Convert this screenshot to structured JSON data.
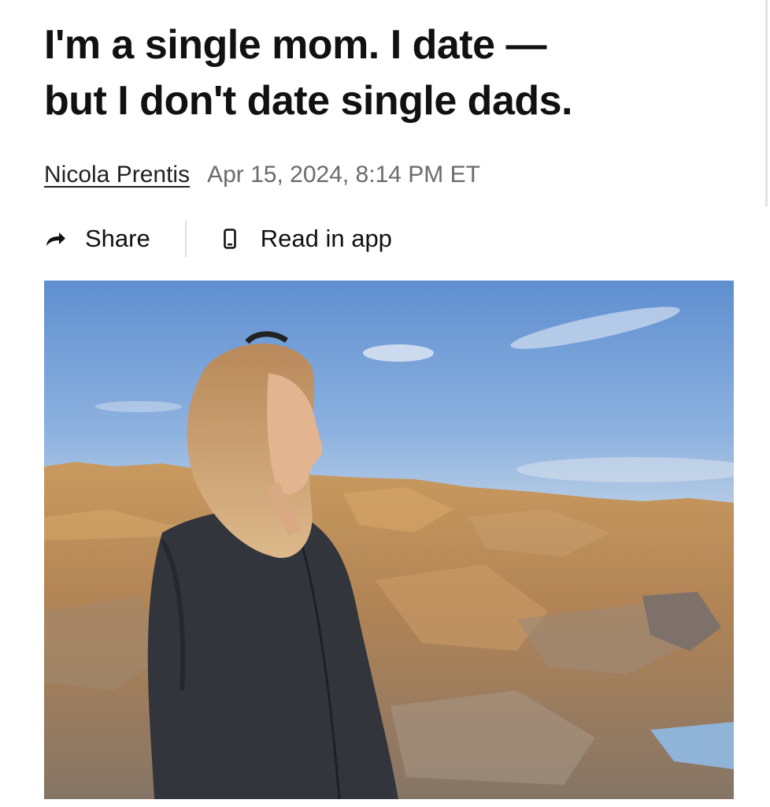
{
  "article": {
    "headline_line1": "I'm a single mom. I date —",
    "headline_line2": "but I don't date single dads.",
    "author": "Nicola Prentis",
    "timestamp": "Apr 15, 2024, 8:14 PM ET"
  },
  "actions": {
    "share_label": "Share",
    "share_icon": "share-arrow-icon",
    "read_in_app_label": "Read in app",
    "read_in_app_icon": "phone-icon"
  },
  "hero_image": {
    "subject": "woman with long blonde hair in dark jacket standing on rocky coastline under blue sky"
  }
}
